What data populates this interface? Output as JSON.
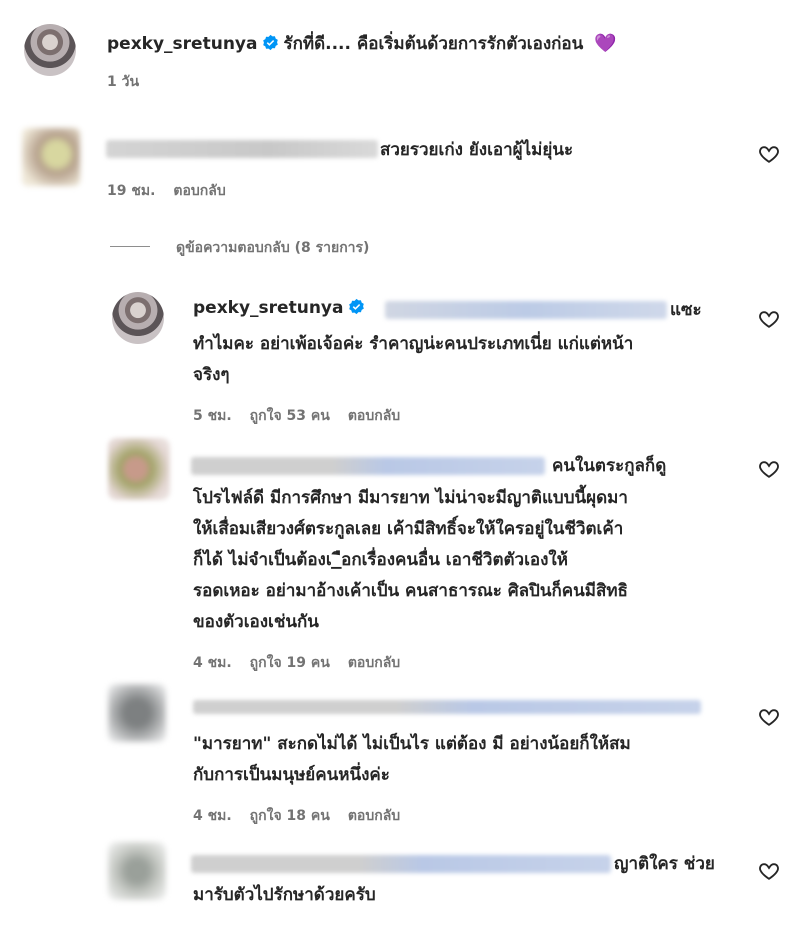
{
  "caption": {
    "username": "pexky_sretunya",
    "text": "รักที่ดี.... คือเริ่มต้นด้วยการรักตัวเองก่อน",
    "heart_emoji": "💜",
    "time": "1 วัน"
  },
  "comment1": {
    "text": "สวยรวยเก่ง ยังเอาผู้ไม่ยุ่นะ",
    "time": "19 ชม.",
    "reply": "ตอบกลับ"
  },
  "view_replies": "ดูข้อความตอบกลับ (8 รายการ)",
  "replies": [
    {
      "username": "pexky_sretunya",
      "line1_tail": "แซะ",
      "lines": [
        "ทำไมคะ อย่าเพ้อเจ้อค่ะ รำคาญน่ะคนประเภทเนี่ย แก่แต่หน้า",
        "จริงๆ"
      ],
      "time": "5 ชม.",
      "likes": "ถูกใจ 53 คน",
      "reply": "ตอบกลับ"
    },
    {
      "line1_tail": "คนในตระกูลก็ดู",
      "lines": [
        "โปรไฟล์ดี มีการศึกษา มีมารยาท ไม่น่าจะมีญาติแบบนี้ผุดมา",
        "ให้เสื่อมเสียวงศ์ตระกูลเลย เค้ามีสิทธิ์จะให้ใครอยู่ในชีวิตเค้า",
        "ก็ได้ ไม่จำเป็นต้องเ_ือกเรื่องคนอื่น เอาชีวิตตัวเองให้",
        "รอดเหอะ อย่ามาอ้างเค้าเป็น คนสาธารณะ ศิลปินก็คนมีสิทธิ",
        "ของตัวเองเช่นกัน"
      ],
      "time": "4 ชม.",
      "likes": "ถูกใจ 19 คน",
      "reply": "ตอบกลับ"
    },
    {
      "lines": [
        "\"มารยาท\" สะกดไม่ได้ ไม่เป็นไร แต่ต้อง มี อย่างน้อยก็ให้สม",
        "กับการเป็นมนุษย์คนหนึ่งค่ะ"
      ],
      "time": "4 ชม.",
      "likes": "ถูกใจ 18 คน",
      "reply": "ตอบกลับ"
    },
    {
      "line1_tail": "ญาติใคร ช่วย",
      "lines": [
        "มารับตัวไปรักษาด้วยครับ"
      ]
    }
  ],
  "icons": [
    "heart-outline-icon",
    "verified-badge-icon"
  ]
}
